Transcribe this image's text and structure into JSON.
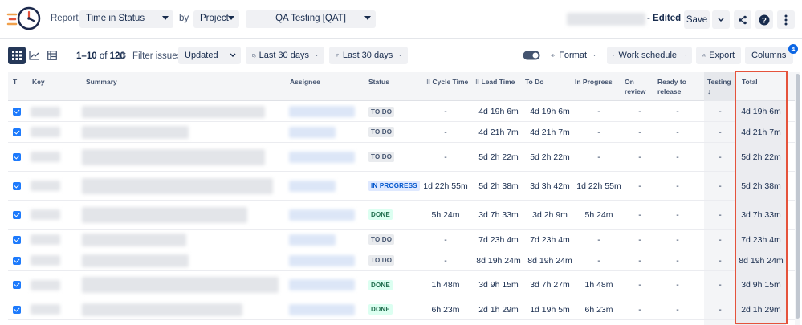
{
  "header": {
    "report_label": "Report:",
    "report_value": "Time in Status",
    "by_label": "by",
    "group_value": "Project",
    "project_value": "QA Testing [QAT]",
    "edited_label": "- Edited",
    "save_label": "Save"
  },
  "toolbar": {
    "range_start": "1",
    "range_end": "10",
    "of_label": "of",
    "total_count": "120",
    "filter_label": "Filter issues:",
    "filter_value": "Updated",
    "date_range_1": "Last 30 days",
    "date_range_2": "Last 30 days",
    "format_label": "Format",
    "work_schedule_label": "Work schedule",
    "export_label": "Export",
    "columns_label": "Columns",
    "columns_badge": "4"
  },
  "table": {
    "columns": {
      "t": "T",
      "key": "Key",
      "summary": "Summary",
      "assignee": "Assignee",
      "status": "Status",
      "cycle_time": "Cycle Time",
      "lead_time": "Lead Time",
      "to_do": "To Do",
      "in_progress": "In Progress",
      "on_review_1": "On",
      "on_review_2": "review",
      "ready_1": "Ready to",
      "ready_2": "release",
      "testing": "Testing",
      "total": "Total"
    },
    "rows": [
      {
        "status": "TO DO",
        "cycle": "-",
        "lead": "4d 19h 6m",
        "todo": "4d 19h 6m",
        "inprog": "-",
        "review": "-",
        "ready": "-",
        "testing": "-",
        "total": "4d 19h 6m"
      },
      {
        "status": "TO DO",
        "cycle": "-",
        "lead": "4d 21h 7m",
        "todo": "4d 21h 7m",
        "inprog": "-",
        "review": "-",
        "ready": "-",
        "testing": "-",
        "total": "4d 21h 7m"
      },
      {
        "status": "TO DO",
        "cycle": "-",
        "lead": "5d 2h 22m",
        "todo": "5d 2h 22m",
        "inprog": "-",
        "review": "-",
        "ready": "-",
        "testing": "-",
        "total": "5d 2h 22m"
      },
      {
        "status": "IN PROGRESS",
        "cycle": "1d 22h 55m",
        "lead": "5d 2h 38m",
        "todo": "3d 3h 42m",
        "inprog": "1d 22h 55m",
        "review": "-",
        "ready": "-",
        "testing": "-",
        "total": "5d 2h 38m"
      },
      {
        "status": "DONE",
        "cycle": "5h 24m",
        "lead": "3d 7h 33m",
        "todo": "3d 2h 9m",
        "inprog": "5h 24m",
        "review": "-",
        "ready": "-",
        "testing": "-",
        "total": "3d 7h 33m"
      },
      {
        "status": "TO DO",
        "cycle": "-",
        "lead": "7d 23h 4m",
        "todo": "7d 23h 4m",
        "inprog": "-",
        "review": "-",
        "ready": "-",
        "testing": "-",
        "total": "7d 23h 4m"
      },
      {
        "status": "TO DO",
        "cycle": "-",
        "lead": "8d 19h 24m",
        "todo": "8d 19h 24m",
        "inprog": "-",
        "review": "-",
        "ready": "-",
        "testing": "-",
        "total": "8d 19h 24m"
      },
      {
        "status": "DONE",
        "cycle": "1h 48m",
        "lead": "3d 9h 15m",
        "todo": "3d 7h 27m",
        "inprog": "1h 48m",
        "review": "-",
        "ready": "-",
        "testing": "-",
        "total": "3d 9h 15m"
      },
      {
        "status": "DONE",
        "cycle": "6h 23m",
        "lead": "2d 1h 29m",
        "todo": "1d 19h 5m",
        "inprog": "6h 23m",
        "review": "-",
        "ready": "-",
        "testing": "-",
        "total": "2d 1h 29m"
      }
    ]
  },
  "colors": {
    "accent": "#0c66e4",
    "highlight_outline": "#e5533c"
  }
}
